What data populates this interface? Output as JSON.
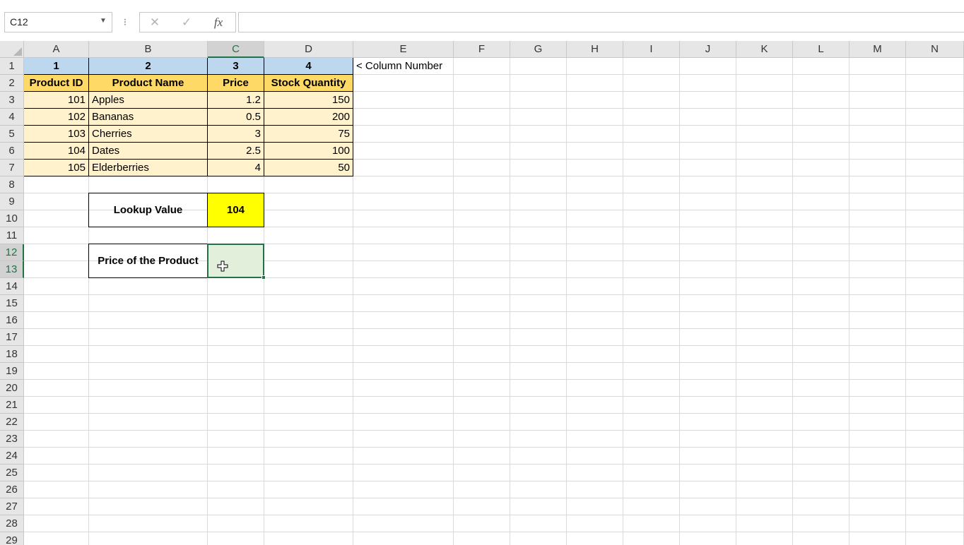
{
  "formula_bar": {
    "name_box": "C12",
    "formula": ""
  },
  "columns": [
    "A",
    "B",
    "C",
    "D",
    "E",
    "F",
    "G",
    "H",
    "I",
    "J",
    "K",
    "L",
    "M",
    "N"
  ],
  "rows": [
    "1",
    "2",
    "3",
    "4",
    "5",
    "6",
    "7",
    "8",
    "9",
    "10",
    "11",
    "12",
    "13",
    "14",
    "15",
    "16",
    "17",
    "18",
    "19",
    "20",
    "21",
    "22",
    "23",
    "24",
    "25",
    "26",
    "27",
    "28",
    "29"
  ],
  "selected_cell": "C12",
  "table": {
    "column_numbers": [
      "1",
      "2",
      "3",
      "4"
    ],
    "column_number_note": "< Column Number",
    "headers": [
      "Product ID",
      "Product Name",
      "Price",
      "Stock Quantity"
    ],
    "rows": [
      [
        "101",
        "Apples",
        "1.2",
        "150"
      ],
      [
        "102",
        "Bananas",
        "0.5",
        "200"
      ],
      [
        "103",
        "Cherries",
        "3",
        "75"
      ],
      [
        "104",
        "Dates",
        "2.5",
        "100"
      ],
      [
        "105",
        "Elderberries",
        "4",
        "50"
      ]
    ]
  },
  "lookup": {
    "label": "Lookup Value",
    "value": "104"
  },
  "result": {
    "label": "Price of the Product",
    "value": ""
  },
  "colors": {
    "column_number_fill": "#bdd7ee",
    "header_fill": "#ffd966",
    "data_fill": "#fff2cc",
    "lookup_fill": "#ffff00",
    "selection_fill": "#e2efda",
    "selection_border": "#217346"
  },
  "icons": {
    "name_box_dropdown": "chevron-down-icon",
    "options": "vertical-dots-icon",
    "cancel": "close-icon",
    "enter": "check-icon",
    "function": "fx-icon",
    "cursor": "cell-cursor-icon"
  }
}
